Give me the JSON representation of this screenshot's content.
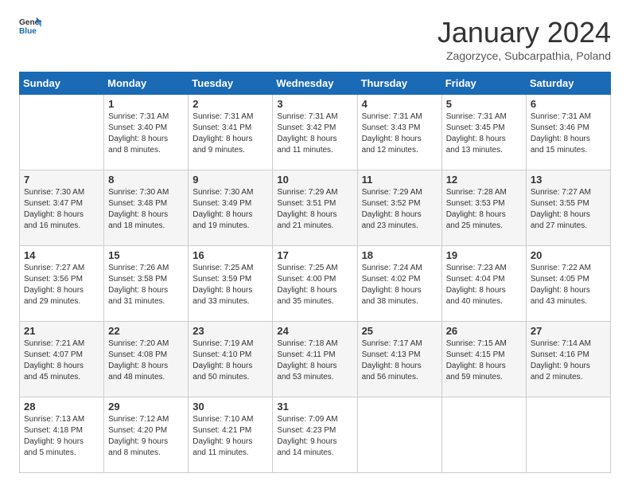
{
  "header": {
    "logo_general": "General",
    "logo_blue": "Blue",
    "month_title": "January 2024",
    "subtitle": "Zagorzyce, Subcarpathia, Poland"
  },
  "weekdays": [
    "Sunday",
    "Monday",
    "Tuesday",
    "Wednesday",
    "Thursday",
    "Friday",
    "Saturday"
  ],
  "weeks": [
    [
      {
        "day": "",
        "info": ""
      },
      {
        "day": "1",
        "info": "Sunrise: 7:31 AM\nSunset: 3:40 PM\nDaylight: 8 hours\nand 8 minutes."
      },
      {
        "day": "2",
        "info": "Sunrise: 7:31 AM\nSunset: 3:41 PM\nDaylight: 8 hours\nand 9 minutes."
      },
      {
        "day": "3",
        "info": "Sunrise: 7:31 AM\nSunset: 3:42 PM\nDaylight: 8 hours\nand 11 minutes."
      },
      {
        "day": "4",
        "info": "Sunrise: 7:31 AM\nSunset: 3:43 PM\nDaylight: 8 hours\nand 12 minutes."
      },
      {
        "day": "5",
        "info": "Sunrise: 7:31 AM\nSunset: 3:45 PM\nDaylight: 8 hours\nand 13 minutes."
      },
      {
        "day": "6",
        "info": "Sunrise: 7:31 AM\nSunset: 3:46 PM\nDaylight: 8 hours\nand 15 minutes."
      }
    ],
    [
      {
        "day": "7",
        "info": "Sunrise: 7:30 AM\nSunset: 3:47 PM\nDaylight: 8 hours\nand 16 minutes."
      },
      {
        "day": "8",
        "info": "Sunrise: 7:30 AM\nSunset: 3:48 PM\nDaylight: 8 hours\nand 18 minutes."
      },
      {
        "day": "9",
        "info": "Sunrise: 7:30 AM\nSunset: 3:49 PM\nDaylight: 8 hours\nand 19 minutes."
      },
      {
        "day": "10",
        "info": "Sunrise: 7:29 AM\nSunset: 3:51 PM\nDaylight: 8 hours\nand 21 minutes."
      },
      {
        "day": "11",
        "info": "Sunrise: 7:29 AM\nSunset: 3:52 PM\nDaylight: 8 hours\nand 23 minutes."
      },
      {
        "day": "12",
        "info": "Sunrise: 7:28 AM\nSunset: 3:53 PM\nDaylight: 8 hours\nand 25 minutes."
      },
      {
        "day": "13",
        "info": "Sunrise: 7:27 AM\nSunset: 3:55 PM\nDaylight: 8 hours\nand 27 minutes."
      }
    ],
    [
      {
        "day": "14",
        "info": "Sunrise: 7:27 AM\nSunset: 3:56 PM\nDaylight: 8 hours\nand 29 minutes."
      },
      {
        "day": "15",
        "info": "Sunrise: 7:26 AM\nSunset: 3:58 PM\nDaylight: 8 hours\nand 31 minutes."
      },
      {
        "day": "16",
        "info": "Sunrise: 7:25 AM\nSunset: 3:59 PM\nDaylight: 8 hours\nand 33 minutes."
      },
      {
        "day": "17",
        "info": "Sunrise: 7:25 AM\nSunset: 4:00 PM\nDaylight: 8 hours\nand 35 minutes."
      },
      {
        "day": "18",
        "info": "Sunrise: 7:24 AM\nSunset: 4:02 PM\nDaylight: 8 hours\nand 38 minutes."
      },
      {
        "day": "19",
        "info": "Sunrise: 7:23 AM\nSunset: 4:04 PM\nDaylight: 8 hours\nand 40 minutes."
      },
      {
        "day": "20",
        "info": "Sunrise: 7:22 AM\nSunset: 4:05 PM\nDaylight: 8 hours\nand 43 minutes."
      }
    ],
    [
      {
        "day": "21",
        "info": "Sunrise: 7:21 AM\nSunset: 4:07 PM\nDaylight: 8 hours\nand 45 minutes."
      },
      {
        "day": "22",
        "info": "Sunrise: 7:20 AM\nSunset: 4:08 PM\nDaylight: 8 hours\nand 48 minutes."
      },
      {
        "day": "23",
        "info": "Sunrise: 7:19 AM\nSunset: 4:10 PM\nDaylight: 8 hours\nand 50 minutes."
      },
      {
        "day": "24",
        "info": "Sunrise: 7:18 AM\nSunset: 4:11 PM\nDaylight: 8 hours\nand 53 minutes."
      },
      {
        "day": "25",
        "info": "Sunrise: 7:17 AM\nSunset: 4:13 PM\nDaylight: 8 hours\nand 56 minutes."
      },
      {
        "day": "26",
        "info": "Sunrise: 7:15 AM\nSunset: 4:15 PM\nDaylight: 8 hours\nand 59 minutes."
      },
      {
        "day": "27",
        "info": "Sunrise: 7:14 AM\nSunset: 4:16 PM\nDaylight: 9 hours\nand 2 minutes."
      }
    ],
    [
      {
        "day": "28",
        "info": "Sunrise: 7:13 AM\nSunset: 4:18 PM\nDaylight: 9 hours\nand 5 minutes."
      },
      {
        "day": "29",
        "info": "Sunrise: 7:12 AM\nSunset: 4:20 PM\nDaylight: 9 hours\nand 8 minutes."
      },
      {
        "day": "30",
        "info": "Sunrise: 7:10 AM\nSunset: 4:21 PM\nDaylight: 9 hours\nand 11 minutes."
      },
      {
        "day": "31",
        "info": "Sunrise: 7:09 AM\nSunset: 4:23 PM\nDaylight: 9 hours\nand 14 minutes."
      },
      {
        "day": "",
        "info": ""
      },
      {
        "day": "",
        "info": ""
      },
      {
        "day": "",
        "info": ""
      }
    ]
  ]
}
